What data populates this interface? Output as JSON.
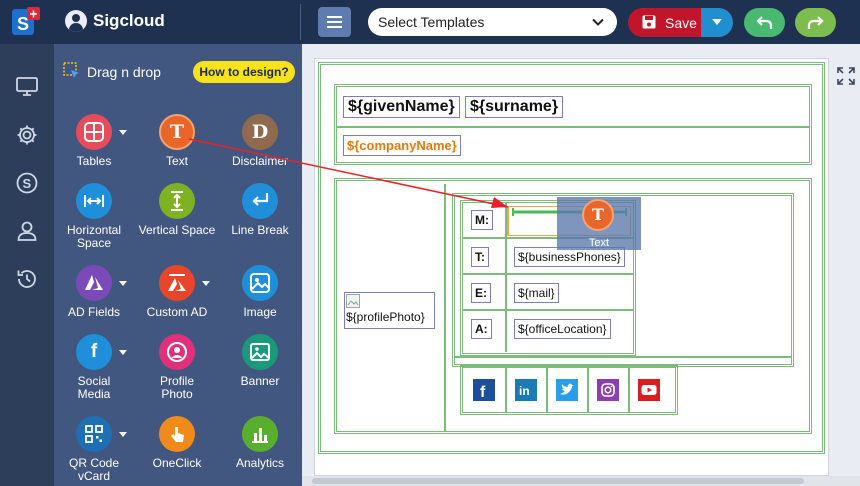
{
  "app": {
    "brand": "Sigcloud",
    "select_templates": "Select Templates",
    "save_label": "Save"
  },
  "panel": {
    "title": "Drag n drop",
    "howto_label": "How to design?",
    "components": [
      {
        "label": "Tables",
        "icon": "table-icon",
        "color": "#e84b5c",
        "caret": true
      },
      {
        "label": "Text",
        "icon": "text-icon",
        "color": "#e8662a",
        "caret": false
      },
      {
        "label": "Disclaimer",
        "icon": "disclaimer-icon",
        "color": "#8f6a4f",
        "caret": false
      },
      {
        "label": "Horizontal Space",
        "icon": "horizontal-space-icon",
        "color": "#1e8fd8",
        "caret": false
      },
      {
        "label": "Vertical Space",
        "icon": "vertical-space-icon",
        "color": "#7fb223",
        "caret": false
      },
      {
        "label": "Line Break",
        "icon": "line-break-icon",
        "color": "#1e8fd8",
        "caret": false
      },
      {
        "label": "AD Fields",
        "icon": "azure-icon",
        "color": "#7a4bb8",
        "caret": true
      },
      {
        "label": "Custom AD",
        "icon": "azure-icon",
        "color": "#e8462a",
        "caret": true
      },
      {
        "label": "Image",
        "icon": "image-icon",
        "color": "#1e8fd8",
        "caret": false
      },
      {
        "label": "Social Media",
        "icon": "facebook-icon",
        "color": "#1e8fd8",
        "caret": true
      },
      {
        "label": "Profile Photo",
        "icon": "profile-photo-icon",
        "color": "#e0307a",
        "caret": false
      },
      {
        "label": "Banner",
        "icon": "banner-icon",
        "color": "#1a9a7a",
        "caret": false
      },
      {
        "label": "QR Code vCard",
        "icon": "qr-code-icon",
        "color": "#1f6fb5",
        "caret": true
      },
      {
        "label": "OneClick",
        "icon": "one-click-icon",
        "color": "#f08a1a",
        "caret": false
      },
      {
        "label": "Analytics",
        "icon": "analytics-icon",
        "color": "#5aae2e",
        "caret": false
      }
    ]
  },
  "signature": {
    "given_name": "${givenName}",
    "surname": "${surname}",
    "company": "${companyName}",
    "profile_photo": "${profilePhoto}",
    "rows": [
      {
        "label": "M:",
        "value": ""
      },
      {
        "label": "T:",
        "value": "${businessPhones}"
      },
      {
        "label": "E:",
        "value": "${mail}"
      },
      {
        "label": "A:",
        "value": "${officeLocation}"
      }
    ],
    "social": [
      {
        "icon": "facebook-icon",
        "color": "#1b4f9c"
      },
      {
        "icon": "linkedin-icon",
        "color": "#1a7ab8"
      },
      {
        "icon": "twitter-icon",
        "color": "#2a9ee8"
      },
      {
        "icon": "instagram-icon",
        "color": "#8a3fb0"
      },
      {
        "icon": "youtube-icon",
        "color": "#d81e1e"
      }
    ]
  },
  "drag": {
    "label": "Text",
    "letter": "T"
  }
}
